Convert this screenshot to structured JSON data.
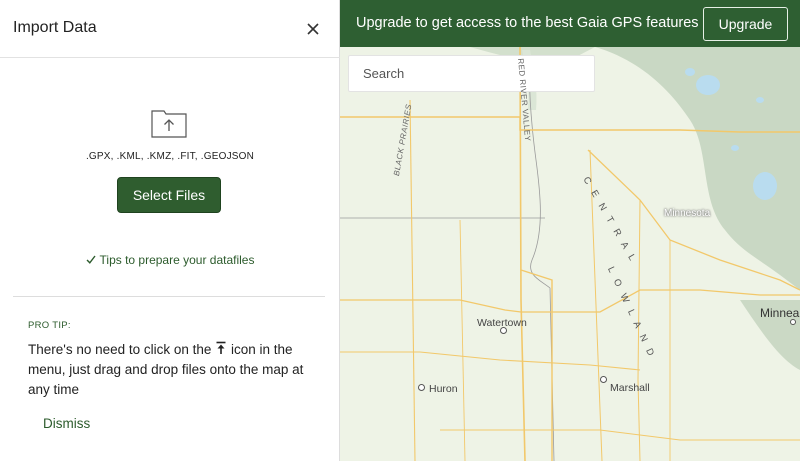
{
  "panel": {
    "title": "Import Data",
    "close_icon": "close-icon",
    "folder_icon": "folder-upload-icon",
    "formats": ".GPX, .KML, .KMZ, .FIT, .GEOJSON",
    "select_files_label": "Select Files",
    "tips_label": "Tips to prepare your datafiles",
    "pro_tip_label": "PRO TIP:",
    "pro_tip_text_before": "There's no need to click on the",
    "pro_tip_text_after": "icon in the menu, just drag and drop files onto the map at any time",
    "dismiss_label": "Dismiss"
  },
  "banner": {
    "text": "Upgrade to get access to the best Gaia GPS features",
    "upgrade_label": "Upgrade"
  },
  "search": {
    "placeholder": "Search"
  },
  "map": {
    "labels": {
      "red_river_valley": "RED RIVER VALLEY",
      "black_prairies": "BLACK PRAIRIES",
      "central": "C E N T R A L",
      "lowland": "L O W L A N D",
      "minnesota": "Minnesota",
      "watertown": "Watertown",
      "huron": "Huron",
      "marshall": "Marshall",
      "minneapolis_partial": "Minnea"
    }
  },
  "colors": {
    "brand_green": "#2e5f32",
    "button_green": "#2f5d2f",
    "map_bg": "#eef3e6",
    "forest": "#c9d8c4",
    "water": "#b9dcef",
    "road": "#f2c86a"
  }
}
